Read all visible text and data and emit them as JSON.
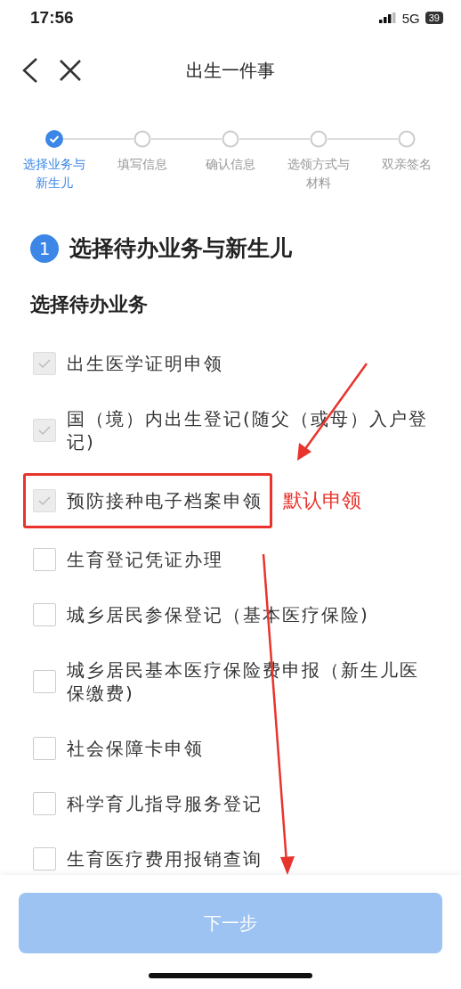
{
  "status_bar": {
    "time": "17:56",
    "network": "5G",
    "battery": "39"
  },
  "header": {
    "title": "出生一件事"
  },
  "steps": [
    {
      "label": "选择业务与新生儿",
      "selected": true
    },
    {
      "label": "填写信息",
      "selected": false
    },
    {
      "label": "确认信息",
      "selected": false
    },
    {
      "label": "选领方式与材料",
      "selected": false
    },
    {
      "label": "双亲签名",
      "selected": false
    }
  ],
  "section": {
    "number": "1",
    "title": "选择待办业务与新生儿"
  },
  "subheading": "选择待办业务",
  "items": [
    {
      "label": "出生医学证明申领",
      "checked": true,
      "disabled": true
    },
    {
      "label": "国（境）内出生登记(随父（或母）入户登记)",
      "checked": true,
      "disabled": true
    },
    {
      "label": "预防接种电子档案申领",
      "checked": true,
      "disabled": true,
      "annotation": "默认申领"
    },
    {
      "label": "生育登记凭证办理",
      "checked": false,
      "disabled": false
    },
    {
      "label": "城乡居民参保登记（基本医疗保险)",
      "checked": false,
      "disabled": false
    },
    {
      "label": "城乡居民基本医疗保险费申报（新生儿医保缴费)",
      "checked": false,
      "disabled": false
    },
    {
      "label": "社会保障卡申领",
      "checked": false,
      "disabled": false
    },
    {
      "label": "科学育儿指导服务登记",
      "checked": false,
      "disabled": false
    },
    {
      "label": "生育医疗费用报销查询",
      "checked": false,
      "disabled": false
    }
  ],
  "next_button": {
    "label": "下一步",
    "disabled": true
  }
}
